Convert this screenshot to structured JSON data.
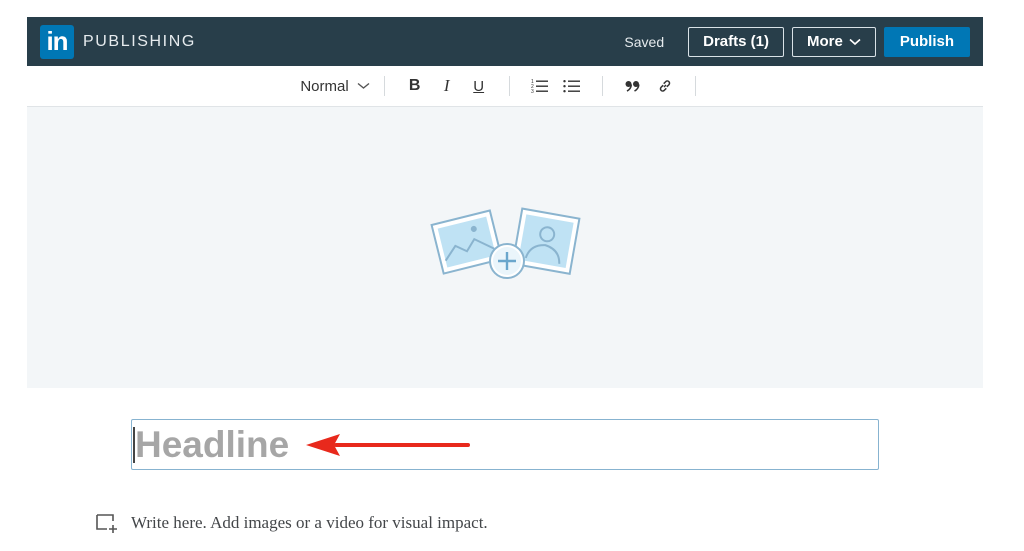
{
  "header": {
    "logo_text": "in",
    "brand": "PUBLISHING",
    "status": "Saved",
    "drafts_label": "Drafts (1)",
    "more_label": "More",
    "publish_label": "Publish"
  },
  "toolbar": {
    "text_style": "Normal",
    "bold": "B",
    "italic": "I",
    "underline": "U"
  },
  "editor": {
    "headline_placeholder": "Headline",
    "body_placeholder": "Write here. Add images or a video for visual impact."
  },
  "annotation": {
    "arrow_color": "#e8291c"
  },
  "colors": {
    "header_bg": "#283e4a",
    "brand_blue": "#0077b5",
    "cover_bg": "#f3f6f8"
  }
}
